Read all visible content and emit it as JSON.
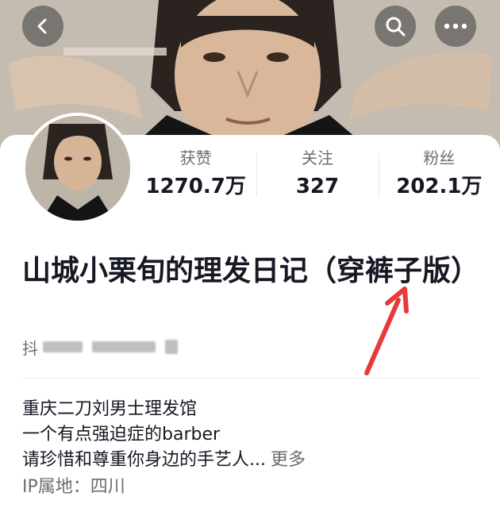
{
  "profile": {
    "stats": [
      {
        "label": "获赞",
        "value": "1270.7万"
      },
      {
        "label": "关注",
        "value": "327"
      },
      {
        "label": "粉丝",
        "value": "202.1万"
      }
    ],
    "name": "山城小栗旬的理发日记（穿裤子版）",
    "account_prefix": "抖",
    "bio": {
      "lines": [
        "重庆二刀刘男士理发馆",
        "一个有点强迫症的barber",
        "请珍惜和尊重你身边的手艺人..."
      ],
      "more_label": "更多"
    },
    "ip_label": "IP属地：",
    "ip_value": "四川"
  },
  "colors": {
    "annotation_arrow": "#e83a3a",
    "stat_label": "#6b6d74"
  },
  "icons": [
    "back-arrow-icon",
    "search-icon",
    "more-dots-icon"
  ]
}
